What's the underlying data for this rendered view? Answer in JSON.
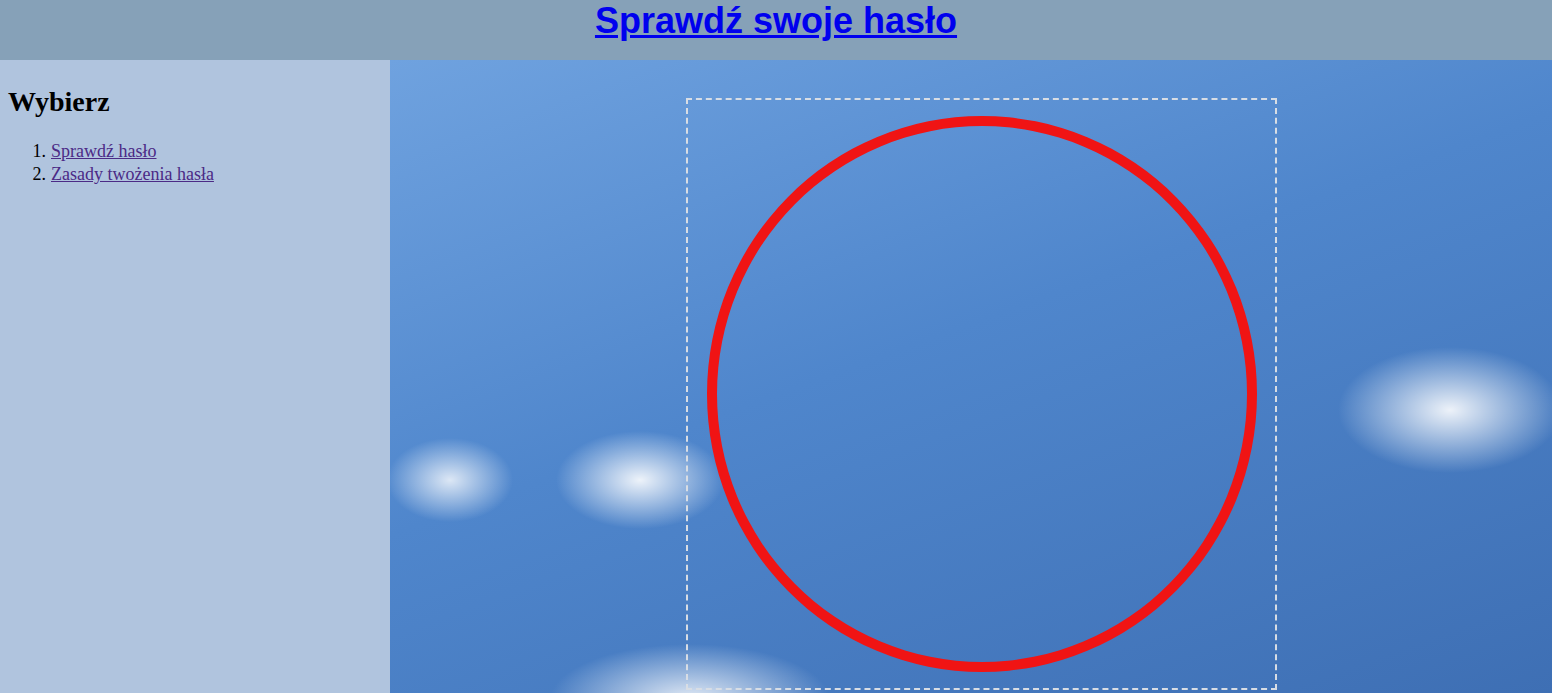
{
  "header": {
    "title": "Sprawdź swoje hasło"
  },
  "sidebar": {
    "heading": "Wybierz",
    "items": [
      {
        "number": "1.",
        "label": "Sprawdź hasło"
      },
      {
        "number": "2.",
        "label": "Zasady twożenia hasła"
      }
    ]
  }
}
